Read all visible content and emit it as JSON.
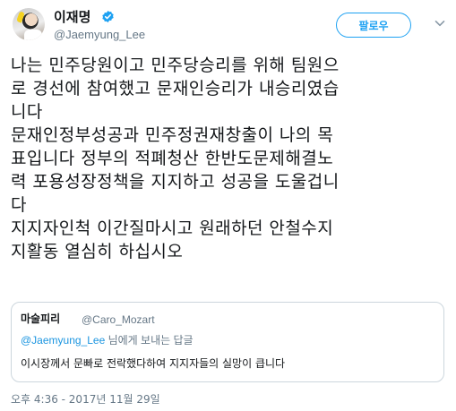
{
  "author": {
    "display_name": "이재명",
    "handle": "@Jaemyung_Lee",
    "verified": true
  },
  "actions": {
    "follow_label": "팔로우"
  },
  "tweet": {
    "lines": [
      "나는 민주당원이고 민주당승리를 위해 팀원으",
      "로 경선에 참여했고 문재인승리가 내승리였습",
      "니다",
      "문재인정부성공과 민주정권재창출이 나의 목",
      "표입니다 정부의 적폐청산 한반도문제해결노",
      "력 포용성장정책을 지지하고 성공을 도울겁니",
      "다",
      "지지자인척 이간질마시고 원래하던 안철수지",
      "지활동 열심히 하십시오"
    ]
  },
  "quoted": {
    "display_name": "마술피리",
    "handle": "@Caro_Mozart",
    "reply_mention": "@Jaemyung_Lee",
    "reply_suffix": " 님에게 보내는 답글",
    "text": "이시장께서 문빠로 전락했다하여 지지자들의 실망이 큽니다"
  },
  "timestamp": "오후 4:36 - 2017년 11월 29일",
  "colors": {
    "accent": "#1da1f2",
    "text": "#14171a",
    "secondary": "#657786",
    "border": "#ccd6dd"
  },
  "icons": {
    "verified": "verified-badge-icon",
    "menu": "chevron-down-icon"
  }
}
